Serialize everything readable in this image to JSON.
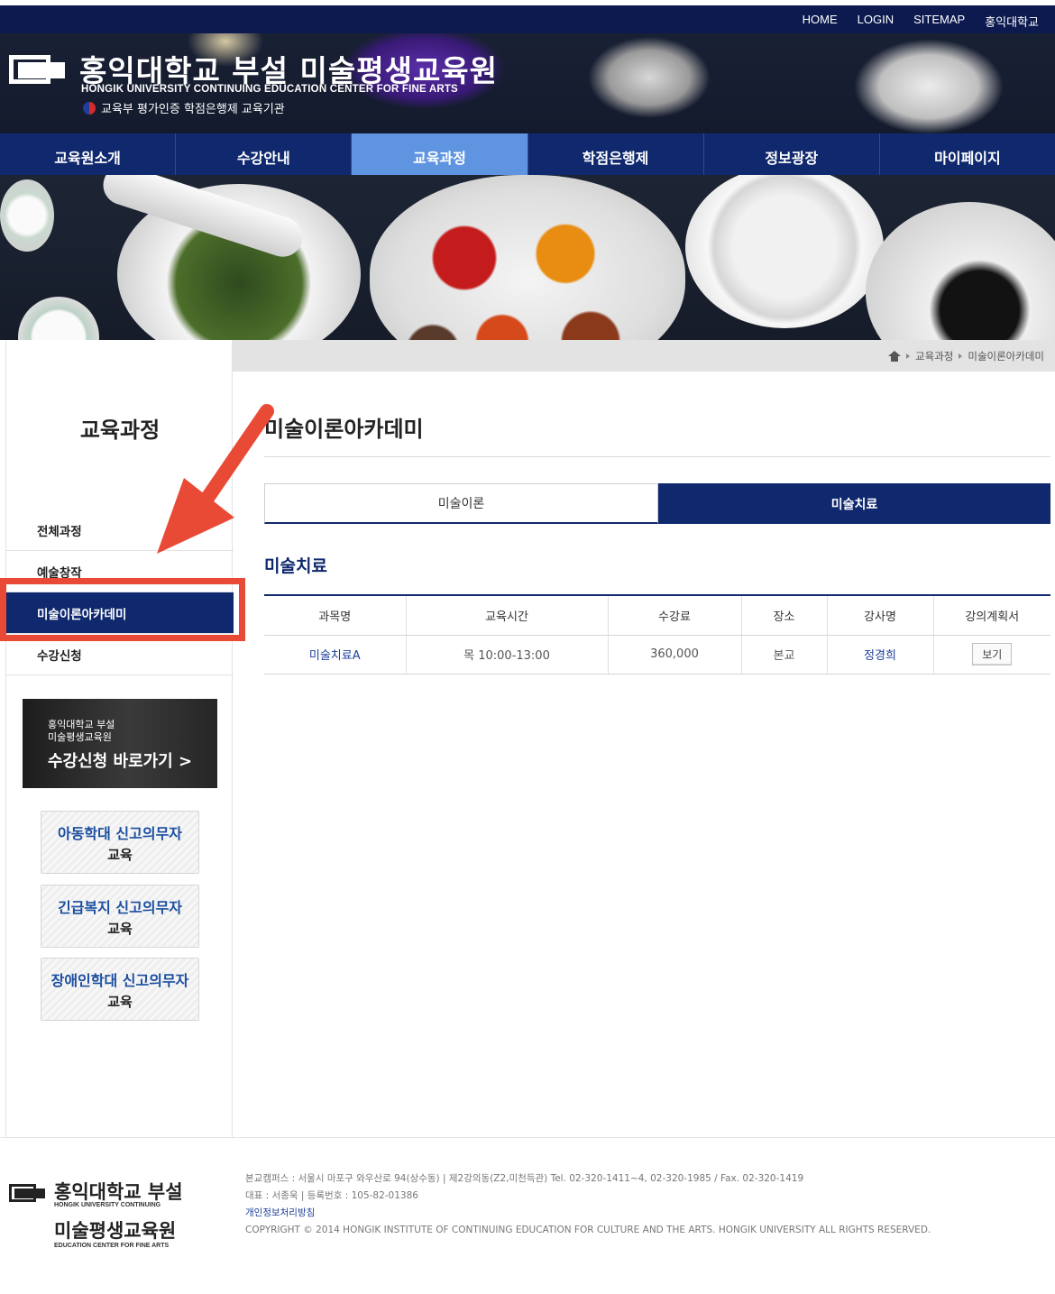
{
  "topbar": {
    "links": [
      "HOME",
      "LOGIN",
      "SITEMAP",
      "홍익대학교"
    ]
  },
  "logo": {
    "title": "홍익대학교 부설 미술평생교육원",
    "subtitle": "HONGIK UNIVERSITY   CONTINUING EDUCATION CENTER FOR FINE ARTS",
    "certification": "교육부 평가인증 학점은행제 교육기관"
  },
  "gnb": {
    "items": [
      "교육원소개",
      "수강안내",
      "교육과정",
      "학점은행제",
      "정보광장",
      "마이페이지"
    ],
    "active_index": 2
  },
  "breadcrumb": {
    "items": [
      "교육과정",
      "미술이론아카데미"
    ]
  },
  "sidebar": {
    "title": "교육과정",
    "menu": [
      "전체과정",
      "예술창작",
      "미술이론아카데미",
      "수강신청"
    ],
    "active_index": 2,
    "apply_banner": {
      "line1": "홍익대학교 부설",
      "line2": "미술평생교육원",
      "line3": "수강신청 바로가기 >"
    },
    "edu_banners": [
      {
        "line1": "아동학대 신고의무자",
        "line2": "교육"
      },
      {
        "line1": "긴급복지 신고의무자",
        "line2": "교육"
      },
      {
        "line1": "장애인학대 신고의무자",
        "line2": "교육"
      }
    ]
  },
  "content": {
    "page_title": "미술이론아카데미",
    "tabs": [
      "미술이론",
      "미술치료"
    ],
    "active_tab": 1,
    "section_title": "미술치료",
    "table": {
      "headers": [
        "과목명",
        "교육시간",
        "수강료",
        "장소",
        "강사명",
        "강의계획서"
      ],
      "rows": [
        {
          "course": "미술치료A",
          "time": "목 10:00-13:00",
          "fee": "360,000",
          "place": "본교",
          "instructor": "정경희",
          "plan": "보기"
        }
      ]
    }
  },
  "footer": {
    "logo_line1": "홍익대학교 부설",
    "logo_en1": "HONGIK UNIVERSITY CONTINUING",
    "logo_line2": "미술평생교육원",
    "logo_en2": "EDUCATION CENTER FOR FINE ARTS",
    "address": "본교캠퍼스 : 서울시 마포구 와우산로 94(상수동)  |  제2강의동(Z2,미천득관) Tel. 02-320-1411~4, 02-320-1985 / Fax. 02-320-1419",
    "rep": "대표 : 서종욱  |  등록번호 : 105-82-01386",
    "privacy": "개인정보처리방침",
    "copyright": "COPYRIGHT © 2014 HONGIK INSTITUTE OF CONTINUING EDUCATION FOR CULTURE AND THE ARTS. HONGIK UNIVERSITY ALL RIGHTS RESERVED."
  },
  "colors": {
    "navy": "#10296e",
    "active_nav": "#5f95e0",
    "annotation_red": "#e94a35",
    "link_blue": "#1d3f9a"
  }
}
